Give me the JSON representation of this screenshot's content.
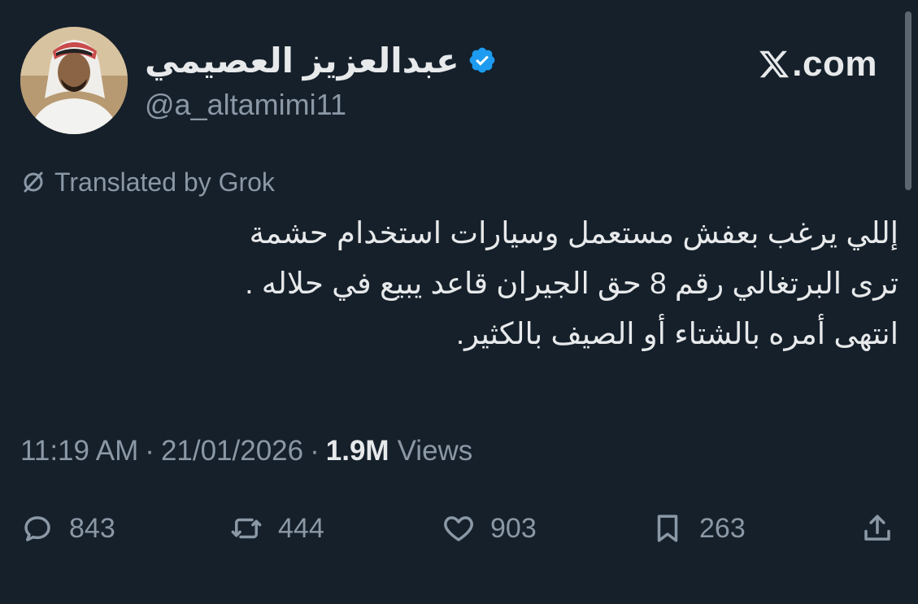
{
  "author": {
    "display_name": "عبدالعزيز العصيمي",
    "handle": "@a_altamimi11",
    "verified": true,
    "verified_color": "#1d9bf0"
  },
  "brand": {
    "logo_icon": "x-logo-icon",
    "label": ".com"
  },
  "translation": {
    "icon": "grok-icon",
    "label": "Translated by Grok"
  },
  "tweet": {
    "lines": [
      "إللي يرغب بعفش مستعمل وسيارات استخدام حشمة",
      "ترى البرتغالي رقم 8 حق الجيران قاعد يبيع في حلاله .",
      "انتهى أمره بالشتاء أو الصيف بالكثير."
    ]
  },
  "meta": {
    "time": "11:19 AM",
    "separator": "·",
    "date": "21/01/2026",
    "views_count": "1.9M",
    "views_label": "Views"
  },
  "actions": {
    "replies": "843",
    "reposts": "444",
    "likes": "903",
    "bookmarks": "263"
  },
  "colors": {
    "background": "#15202b",
    "primary_text": "#e7e9ea",
    "secondary_text": "#8b98a5"
  }
}
